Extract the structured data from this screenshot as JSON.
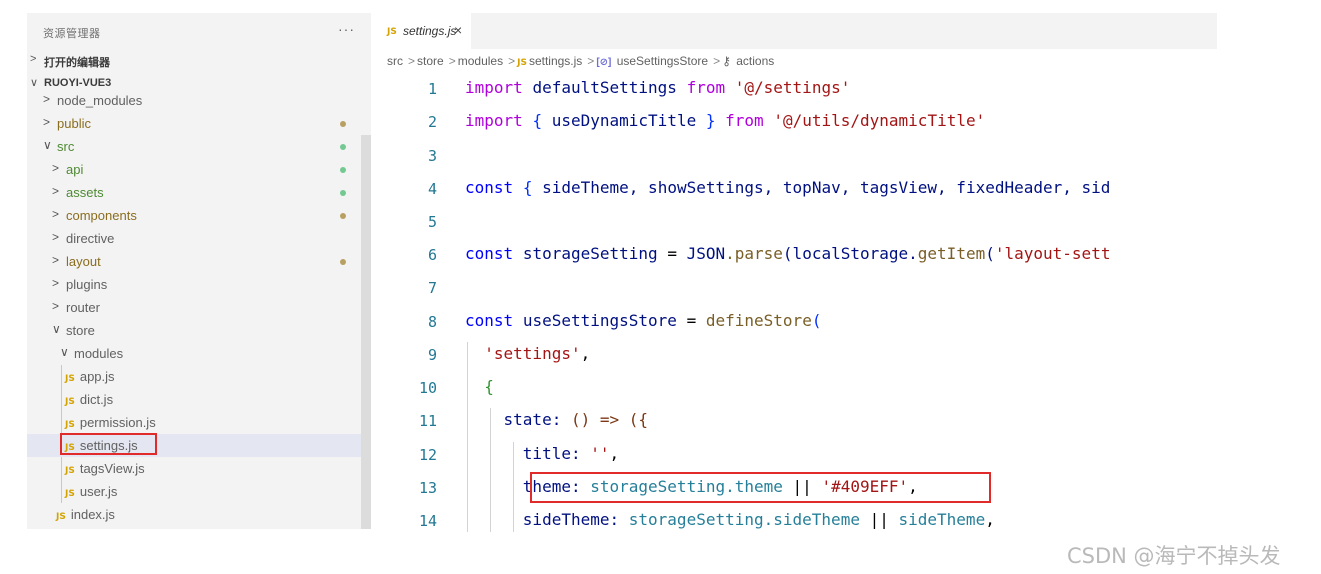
{
  "explorer": {
    "title": "资源管理器",
    "more": "···",
    "open_editors": "打开的编辑器",
    "project": "RUOYI-VUE3"
  },
  "tree": {
    "node_modules": "node_modules",
    "public": "public",
    "src": "src",
    "api": "api",
    "assets": "assets",
    "components": "components",
    "directive": "directive",
    "layout": "layout",
    "plugins": "plugins",
    "router": "router",
    "store": "store",
    "modules": "modules",
    "app": "app.js",
    "dict": "dict.js",
    "permission": "permission.js",
    "settings": "settings.js",
    "tagsView": "tagsView.js",
    "user": "user.js",
    "index": "index.js"
  },
  "icons": {
    "js": "JS",
    "chevron_right": "›",
    "chevron_down": "⌄"
  },
  "tab": {
    "label": "settings.js",
    "close": "×"
  },
  "breadcrumb": {
    "p1": "src",
    "p2": "store",
    "p3": "modules",
    "p4": "settings.js",
    "p5": "useSettingsStore",
    "p6": "actions",
    "icon5": "[⊘]",
    "icon6": "⚷"
  },
  "lines": [
    "1",
    "2",
    "3",
    "4",
    "5",
    "6",
    "7",
    "8",
    "9",
    "10",
    "11",
    "12",
    "13",
    "14"
  ],
  "code": {
    "l1_import": "import",
    "l1_name": "defaultSettings",
    "l1_from": "from",
    "l1_str": "'@/settings'",
    "l2_import": "import",
    "l2_ob": "{",
    "l2_name": "useDynamicTitle",
    "l2_cb": "}",
    "l2_from": "from",
    "l2_str": "'@/utils/dynamicTitle'",
    "l4_const": "const",
    "l4_ob": "{",
    "l4_vars": "sideTheme, showSettings, topNav, tagsView, fixedHeader, sid",
    "l6_const": "const",
    "l6_var": "storageSetting",
    "l6_eq": "=",
    "l6_json": "JSON",
    "l6_parse": ".parse",
    "l6_p1": "(localStorage.",
    "l6_getitem": "getItem",
    "l6_p2": "(",
    "l6_str": "'layout-sett",
    "l8_const": "const",
    "l8_var": "useSettingsStore",
    "l8_eq": "=",
    "l8_fn": "defineStore",
    "l8_p": "(",
    "l9_str": "'settings'",
    "l9_comma": ",",
    "l10_brace": "{",
    "l11_key": "state:",
    "l11_rest": "() => ({",
    "l12_key": "title:",
    "l12_str": "''",
    "l12_comma": ",",
    "l13_key": "theme:",
    "l13_obj": "storageSetting",
    "l13_prop": ".theme",
    "l13_or": "||",
    "l13_str": "'#409EFF'",
    "l13_comma": ",",
    "l14_key": "sideTheme:",
    "l14_obj": "storageSetting",
    "l14_prop": ".sideTheme",
    "l14_or": "||",
    "l14_val": "sideTheme",
    "l14_comma": ","
  },
  "watermark": "CSDN @海宁不掉头发",
  "colors": {
    "keyword": "#af00db",
    "string": "#a31515",
    "function": "#795e26",
    "variable": "#001080",
    "line_number": "#237893",
    "highlight_box": "#e12b2b"
  }
}
